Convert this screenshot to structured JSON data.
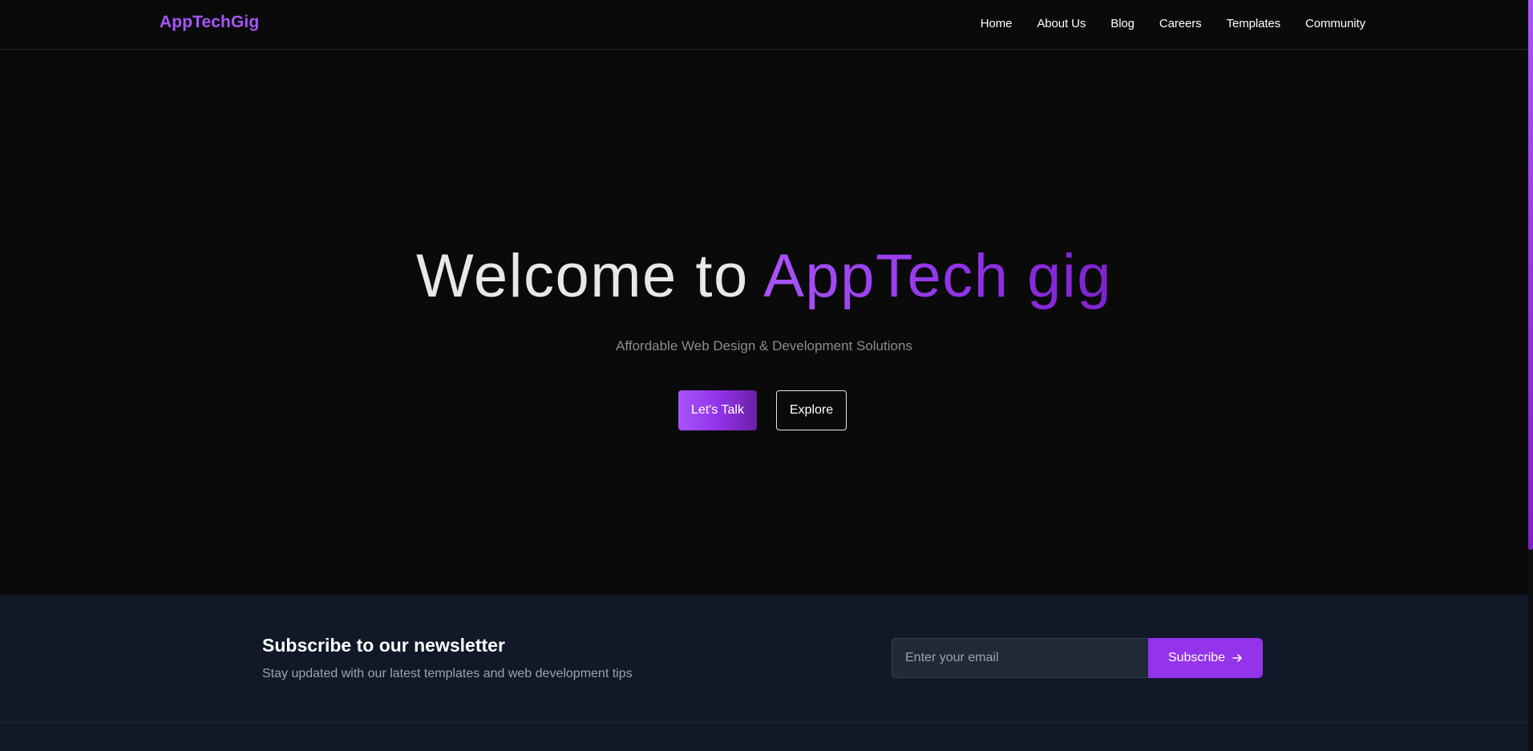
{
  "header": {
    "logo": "AppTechGig",
    "nav": [
      "Home",
      "About Us",
      "Blog",
      "Careers",
      "Templates",
      "Community"
    ]
  },
  "hero": {
    "title_prefix": "Welcome to ",
    "title_brand": "AppTech gig",
    "subtitle": "Affordable Web Design & Development Solutions",
    "primary_button": "Let's Talk",
    "secondary_button": "Explore"
  },
  "newsletter": {
    "title": "Subscribe to our newsletter",
    "description": "Stay updated with our latest templates and web development tips",
    "email_placeholder": "Enter your email",
    "subscribe_label": "Subscribe",
    "subscribe_icon": "arrow-right-icon"
  },
  "colors": {
    "accent": "#a855f7",
    "accent_dark": "#7e22ce",
    "background": "#0a0a0b",
    "newsletter_bg": "#111827"
  }
}
